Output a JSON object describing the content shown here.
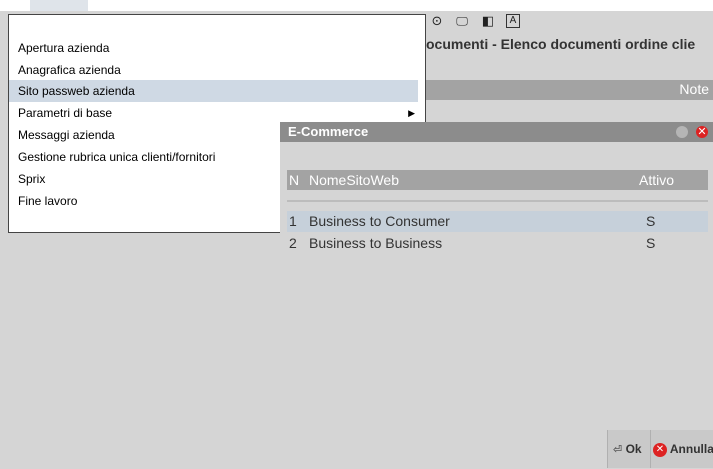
{
  "toolbar": {
    "icons": [
      "radio-icon",
      "monitor-icon",
      "panel-icon",
      "font-size-icon"
    ],
    "glyphs": [
      "⊙",
      "🖵",
      "◧",
      "A"
    ]
  },
  "background_window": {
    "title": "ocumenti - Elenco documenti ordine clie",
    "column_note": "Note"
  },
  "menu": {
    "items": [
      {
        "label": "Apertura azienda",
        "selected": false,
        "submenu": false
      },
      {
        "label": "Anagrafica azienda",
        "selected": false,
        "submenu": false
      },
      {
        "label": "Sito passweb azienda",
        "selected": true,
        "submenu": false
      },
      {
        "label": "Parametri di base",
        "selected": false,
        "submenu": true
      },
      {
        "label": "Messaggi azienda",
        "selected": false,
        "submenu": false
      },
      {
        "label": "Gestione rubrica unica clienti/fornitori",
        "selected": false,
        "submenu": false
      },
      {
        "label": "Sprix",
        "selected": false,
        "submenu": false
      },
      {
        "label": "Fine lavoro",
        "selected": false,
        "submenu": false
      }
    ],
    "submenu_arrow": "▶"
  },
  "dialog": {
    "title": "E-Commerce",
    "close_glyph": "✕",
    "columns": {
      "n": "N",
      "name": "NomeSitoWeb",
      "active": "Attivo"
    },
    "rows": [
      {
        "n": "1",
        "name": "Business to Consumer",
        "active": "S",
        "selected": true
      },
      {
        "n": "2",
        "name": "Business to Business",
        "active": "S",
        "selected": false
      }
    ],
    "buttons": {
      "ok": "Ok",
      "cancel": "Annulla",
      "ok_glyph": "⏎",
      "cancel_glyph": "✕"
    }
  },
  "colors": {
    "selection": "#cfd9e4",
    "title_bar": "#8c8c8c",
    "header": "#a3a3a3",
    "close_red": "#dd2222"
  }
}
